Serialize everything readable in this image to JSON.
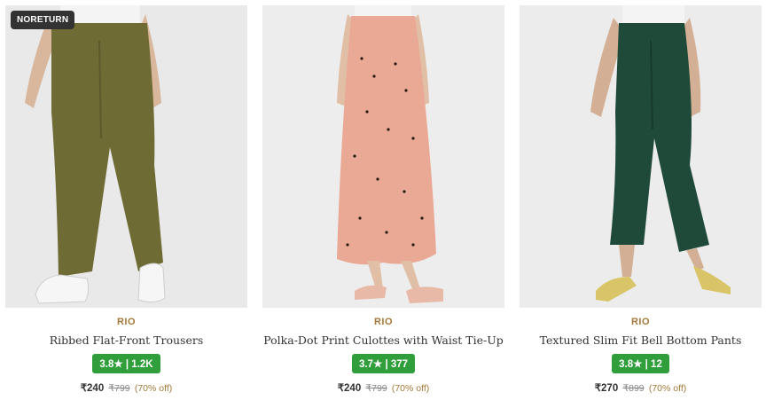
{
  "products": [
    {
      "badge": "NORETURN",
      "brand": "RIO",
      "name": "Ribbed Flat-Front Trousers",
      "rating": "3.8★ | 1.2K",
      "price": "₹240",
      "mrp": "₹799",
      "discount": "(70% off)",
      "garment_color": "#6e6b34"
    },
    {
      "brand": "RIO",
      "name": "Polka-Dot Print Culottes with Waist Tie-Up",
      "rating": "3.7★ | 377",
      "price": "₹240",
      "mrp": "₹799",
      "discount": "(70% off)",
      "garment_color": "#eaa995"
    },
    {
      "brand": "RIO",
      "name": "Textured Slim Fit Bell Bottom Pants",
      "rating": "3.8★ | 12",
      "price": "₹270",
      "mrp": "₹899",
      "discount": "(70% off)",
      "garment_color": "#1f4a3a"
    }
  ],
  "colors": {
    "brand": "#a27a3a",
    "rating_bg": "#2f9e3b"
  }
}
